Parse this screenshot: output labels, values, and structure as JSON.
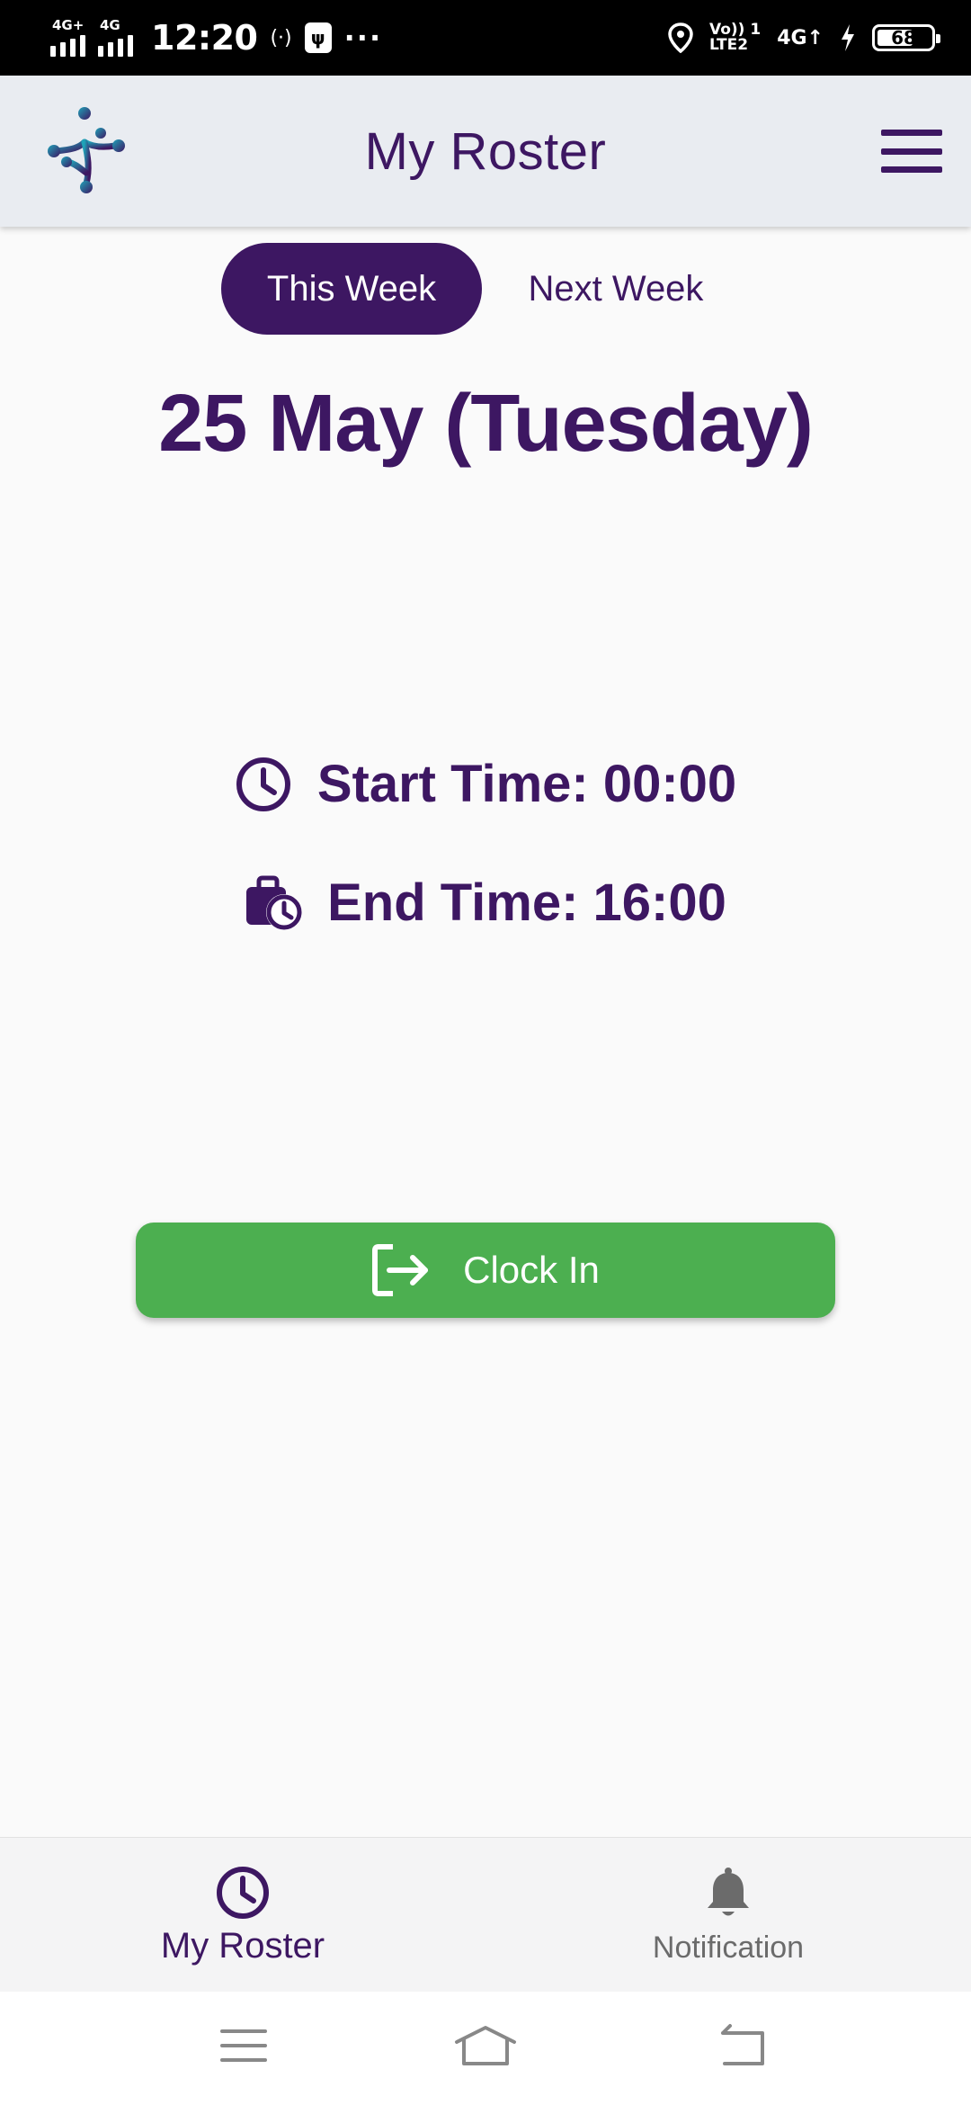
{
  "status_bar": {
    "sim1_network": "4G+",
    "sim2_network": "4G",
    "time": "12:20",
    "hotspot_glyph": "(·)",
    "usb_glyph": "ψ",
    "more_dots": "···",
    "volte_line1": "Vo)) 1",
    "volte_line2": "LTE2",
    "data_network": "4G↑",
    "battery_level": "68",
    "battery_fraction": 0.68,
    "icons": [
      "signal-icon",
      "hotspot-icon",
      "usb-debug-icon",
      "location-icon",
      "charging-icon",
      "battery-icon"
    ]
  },
  "app_bar": {
    "title": "My Roster",
    "logo_icon": "molecule-logo-icon",
    "menu_icon": "hamburger-menu-icon"
  },
  "week_tabs": {
    "active": "this_week",
    "this_week": "This Week",
    "next_week": "Next Week"
  },
  "shift": {
    "date": "25 May (Tuesday)",
    "start_label": "Start Time: 00:00",
    "end_label": "End Time: 16:00",
    "start_icon": "clock-icon",
    "end_icon": "work-bag-clock-icon"
  },
  "clock_in": {
    "label": "Clock In",
    "icon": "login-icon",
    "color": "#4caf50"
  },
  "bottom_nav": {
    "items": [
      {
        "label": "My Roster",
        "icon": "clock-icon",
        "active": true
      },
      {
        "label": "Notification",
        "icon": "bell-icon",
        "active": false
      }
    ]
  },
  "system_nav": {
    "icons": [
      "menu-icon",
      "home-icon",
      "back-icon"
    ]
  },
  "colors": {
    "brand": "#3d1762",
    "app_bar_bg": "#e9ecf1",
    "page_bg": "#fafafa",
    "inactive_nav": "#6b6b6b"
  }
}
